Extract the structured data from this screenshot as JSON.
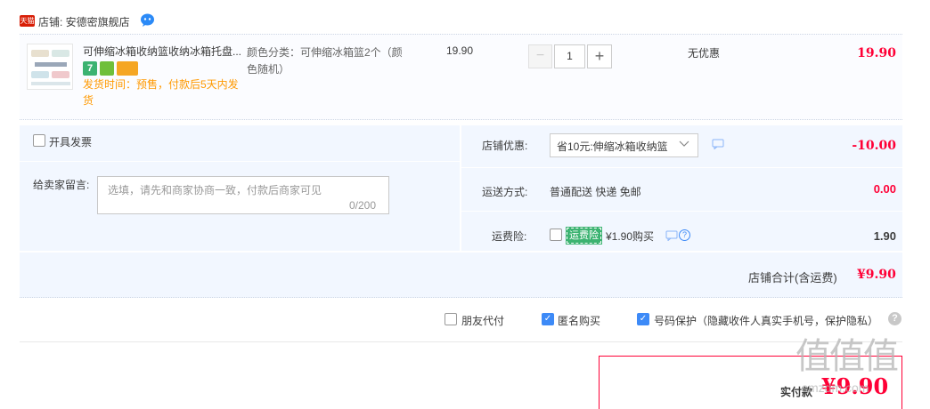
{
  "shop": {
    "badge": "天猫",
    "label": "店铺: 安德密旗舰店"
  },
  "item": {
    "title": "可伸缩冰箱收纳篮收纳冰箱托盘...",
    "ship_time": "发货时间：预售，付款后5天内发货",
    "sku": "颜色分类：可伸缩冰箱篮2个（颜色随机）",
    "unit_price": "19.90",
    "quantity": "1",
    "qty_minus": "−",
    "qty_plus": "+",
    "discount": "无优惠",
    "total": "19.90"
  },
  "invoice": {
    "label": "开具发票"
  },
  "message": {
    "label": "给卖家留言:",
    "placeholder": "选填，请先和商家协商一致，付款后商家可见",
    "count": "0/200"
  },
  "shop_discount": {
    "label": "店铺优惠:",
    "selected": "省10元:伸缩冰箱收纳篮",
    "amount": "-10.00"
  },
  "shipping": {
    "label": "运送方式:",
    "value": "普通配送 快递 免邮",
    "amount": "0.00"
  },
  "insurance": {
    "label": "运费险:",
    "badge": "运费险",
    "price": "¥1.90购买",
    "help": "?",
    "amount": "1.90"
  },
  "subtotal": {
    "label": "店铺合计(含运费)",
    "amount": "¥9.90"
  },
  "options": {
    "friend_pay": "朋友代付",
    "anonymous": "匿名购买",
    "privacy": "号码保护（隐藏收件人真实手机号，保护隐私）",
    "help": "?"
  },
  "payment": {
    "label": "实付款",
    "amount": "¥9.90"
  },
  "watermark": {
    "main": "值值值",
    "sub": "smzdm.com"
  },
  "colors": {
    "price_red": "#ff0036",
    "panel_bg": "#f2f7ff",
    "accent_blue": "#3d8af7",
    "ship_orange": "#ff9900"
  }
}
